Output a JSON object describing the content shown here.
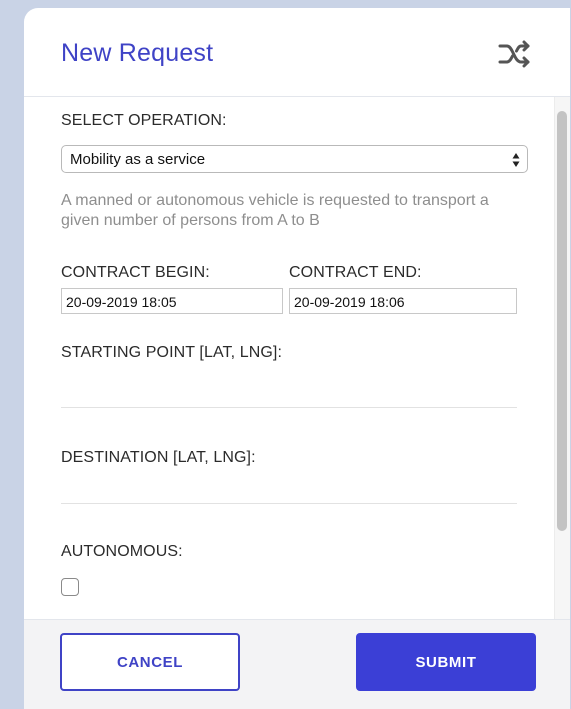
{
  "modal": {
    "title": "New Request"
  },
  "form": {
    "operation_label": "SELECT OPERATION:",
    "operation_selected": "Mobility as a service",
    "operation_description": "A manned or autonomous vehicle is requested to transport a given number of persons from A to B",
    "contract_begin_label": "CONTRACT BEGIN:",
    "contract_begin_value": "20-09-2019 18:05",
    "contract_end_label": "CONTRACT END:",
    "contract_end_value": "20-09-2019 18:06",
    "starting_point_label": "STARTING POINT [LAT, LNG]:",
    "starting_point_value": "",
    "destination_label": "DESTINATION [LAT, LNG]:",
    "destination_value": "",
    "autonomous_label": "AUTONOMOUS:",
    "autonomous_checked": false
  },
  "footer": {
    "cancel_label": "CANCEL",
    "submit_label": "SUBMIT"
  },
  "icons": {
    "header_action": "shuffle-icon",
    "select_control": "select-arrows-icon"
  },
  "colors": {
    "accent": "#3f43c6",
    "submit_bg": "#3b3fd6",
    "backdrop": "#c9d3e6",
    "description_text": "#8e8e8e"
  }
}
